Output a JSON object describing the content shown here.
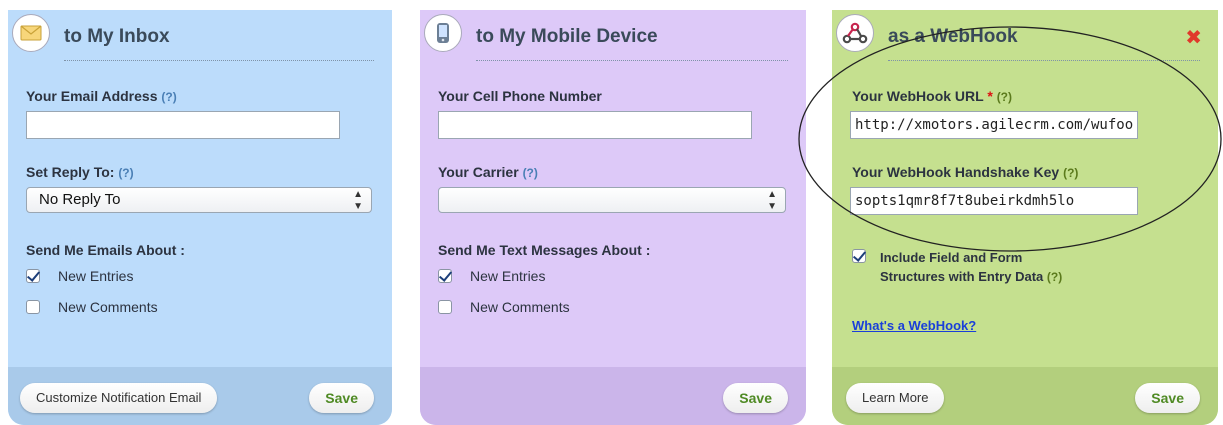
{
  "panels": {
    "inbox": {
      "title": "to My Inbox",
      "icon": "envelope-icon",
      "email_label": "Your Email Address",
      "email_help": "(?)",
      "email_value": "",
      "reply_label": "Set Reply To:",
      "reply_help": "(?)",
      "reply_selected": "No Reply To",
      "send_label": "Send Me Emails About :",
      "opt_new_entries": "New Entries",
      "opt_new_entries_checked": true,
      "opt_new_comments": "New Comments",
      "opt_new_comments_checked": false,
      "customize_button": "Customize Notification Email",
      "save_button": "Save"
    },
    "mobile": {
      "title": "to My Mobile Device",
      "icon": "mobile-phone-icon",
      "phone_label": "Your Cell Phone Number",
      "phone_value": "",
      "carrier_label": "Your Carrier",
      "carrier_help": "(?)",
      "carrier_selected": "",
      "send_label": "Send Me Text Messages About :",
      "opt_new_entries": "New Entries",
      "opt_new_entries_checked": true,
      "opt_new_comments": "New Comments",
      "opt_new_comments_checked": false,
      "save_button": "Save"
    },
    "webhook": {
      "title": "as a WebHook",
      "icon": "webhook-icon",
      "url_label": "Your WebHook URL",
      "url_required": "*",
      "url_help": "(?)",
      "url_value": "http://xmotors.agilecrm.com/wufoo",
      "key_label": "Your WebHook Handshake Key",
      "key_help": "(?)",
      "key_value": "sopts1qmr8f7t8ubeirkdmh5lo",
      "include_line1": "Include Field and Form",
      "include_line2": "Structures with Entry Data",
      "include_help": "(?)",
      "include_checked": true,
      "whats_link": "What's a WebHook?",
      "learn_more_button": "Learn More",
      "save_button": "Save"
    }
  },
  "colors": {
    "inbox_bg": "#bcdcfb",
    "mobile_bg": "#ddc9f8",
    "webhook_bg": "#c5e08f",
    "save_green": "#4f8a24",
    "close_red": "#e0392b"
  }
}
